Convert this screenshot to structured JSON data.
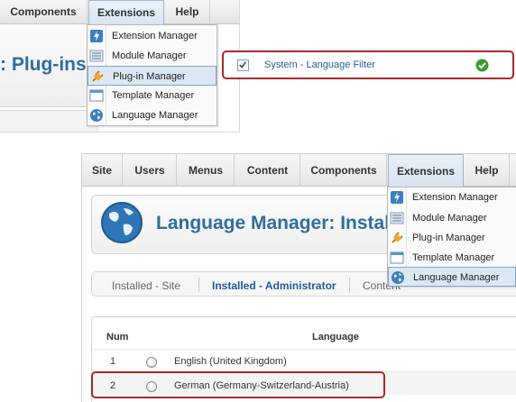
{
  "colors": {
    "title_blue": "#2e6e9e",
    "link_blue": "#1f5c99",
    "callout_red": "#a8282d",
    "menu_highlight": "#dbe8f4",
    "status_green": "#3c9a2f"
  },
  "panel_a": {
    "menubar": {
      "components": "Components",
      "extensions": "Extensions",
      "help": "Help"
    },
    "page_title": ": Plug-ins",
    "dropdown": [
      {
        "label": "Extension Manager",
        "icon": "lightning-icon"
      },
      {
        "label": "Module Manager",
        "icon": "module-list-icon"
      },
      {
        "label": "Plug-in Manager",
        "icon": "plug-icon",
        "highlighted": true
      },
      {
        "label": "Template Manager",
        "icon": "template-icon"
      },
      {
        "label": "Language Manager",
        "icon": "globe-icon"
      }
    ]
  },
  "panel_b": {
    "plugin_name": "System - Language Filter",
    "checked": true,
    "status_icon": "enabled-check-icon"
  },
  "panel_c": {
    "menubar": {
      "site": "Site",
      "users": "Users",
      "menus": "Menus",
      "content": "Content",
      "components": "Components",
      "extensions": "Extensions",
      "help": "Help"
    },
    "page_title": "Language Manager: Instal",
    "tabs": [
      "Installed - Site",
      "Installed - Administrator",
      "Content"
    ],
    "table": {
      "headers": {
        "num": "Num",
        "language": "Language"
      },
      "rows": [
        {
          "num": "1",
          "language": "English (United Kingdom)"
        },
        {
          "num": "2",
          "language": "German (Germany-Switzerland-Austria)"
        }
      ]
    },
    "dropdown": [
      {
        "label": "Extension Manager",
        "icon": "lightning-icon"
      },
      {
        "label": "Module Manager",
        "icon": "module-list-icon"
      },
      {
        "label": "Plug-in Manager",
        "icon": "plug-icon"
      },
      {
        "label": "Template Manager",
        "icon": "template-icon"
      },
      {
        "label": "Language Manager",
        "icon": "globe-icon",
        "highlighted": true
      }
    ]
  }
}
